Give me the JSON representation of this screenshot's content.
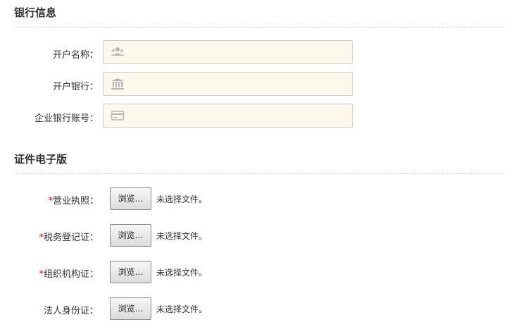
{
  "bank_section": {
    "title": "银行信息",
    "fields": [
      {
        "label": "开户名称：",
        "icon": "users-icon",
        "value": ""
      },
      {
        "label": "开户银行：",
        "icon": "bank-icon",
        "value": ""
      },
      {
        "label": "企业银行账号：",
        "icon": "card-icon",
        "value": ""
      }
    ]
  },
  "cert_section": {
    "title": "证件电子版",
    "uploads": [
      {
        "required_mark": "*",
        "label": "营业执照：",
        "button": "浏览…",
        "status": "未选择文件。"
      },
      {
        "required_mark": "*",
        "label": "税务登记证：",
        "button": "浏览…",
        "status": "未选择文件。"
      },
      {
        "required_mark": "*",
        "label": "组织机构证：",
        "button": "浏览…",
        "status": "未选择文件。"
      },
      {
        "required_mark": "",
        "label": "法人身份证：",
        "button": "浏览…",
        "status": "未选择文件。"
      }
    ]
  },
  "colors": {
    "input_bg": "#fdf8ec",
    "required": "#ee0000"
  }
}
